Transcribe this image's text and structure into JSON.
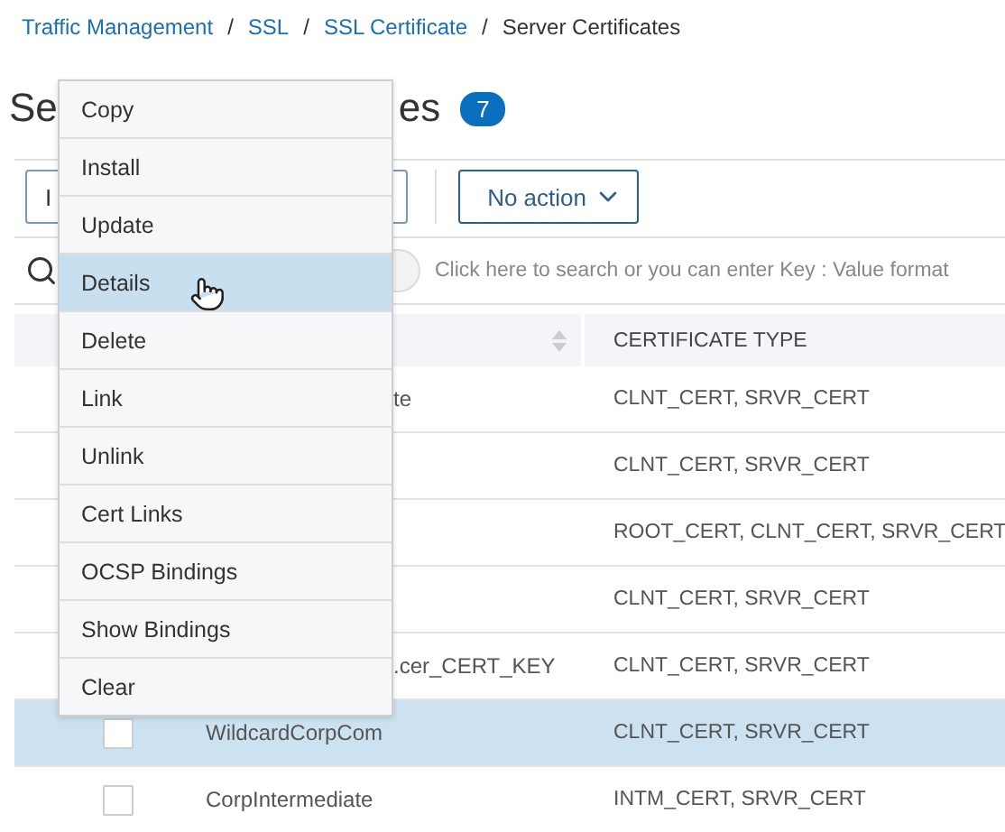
{
  "breadcrumb": {
    "separator": "/",
    "items": [
      {
        "label": "Traffic Management",
        "link": true
      },
      {
        "label": "SSL",
        "link": true
      },
      {
        "label": "SSL Certificate",
        "link": true
      },
      {
        "label": "Server Certificates",
        "link": false
      }
    ]
  },
  "title": {
    "start": "Se",
    "end": "es",
    "count": "7"
  },
  "toolbar": {
    "first_button": "I",
    "action_select": "No action"
  },
  "search": {
    "placeholder": "Click here to search or you can enter Key : Value format"
  },
  "table": {
    "columns": [
      {
        "sortable": true
      },
      {
        "label": "CERTIFICATE TYPE"
      }
    ],
    "rows": [
      {
        "name": "te",
        "name_covered": true,
        "type": "CLNT_CERT, SRVR_CERT",
        "selected": false
      },
      {
        "type": "CLNT_CERT, SRVR_CERT",
        "selected": false
      },
      {
        "type": "ROOT_CERT, CLNT_CERT, SRVR_CERT",
        "selected": false
      },
      {
        "type": "CLNT_CERT, SRVR_CERT",
        "selected": false
      },
      {
        "name": ".cer_CERT_KEY",
        "name_covered": true,
        "type": "CLNT_CERT, SRVR_CERT",
        "selected": false
      },
      {
        "name": "WildcardCorpCom",
        "name_covered": false,
        "checked": false,
        "type": "CLNT_CERT, SRVR_CERT",
        "selected": true
      },
      {
        "name": "CorpIntermediate",
        "name_covered": false,
        "checked": false,
        "type": "INTM_CERT, SRVR_CERT",
        "selected": false
      }
    ]
  },
  "context_menu": [
    {
      "label": "Copy",
      "selected": false
    },
    {
      "label": "Install",
      "selected": false
    },
    {
      "label": "Update",
      "selected": false
    },
    {
      "label": "Details",
      "selected": true
    },
    {
      "label": "Delete",
      "selected": false
    },
    {
      "label": "Link",
      "selected": false
    },
    {
      "label": "Unlink",
      "selected": false
    },
    {
      "label": "Cert Links",
      "selected": false
    },
    {
      "label": "OCSP Bindings",
      "selected": false
    },
    {
      "label": "Show Bindings",
      "selected": false
    },
    {
      "label": "Clear",
      "selected": false
    }
  ]
}
